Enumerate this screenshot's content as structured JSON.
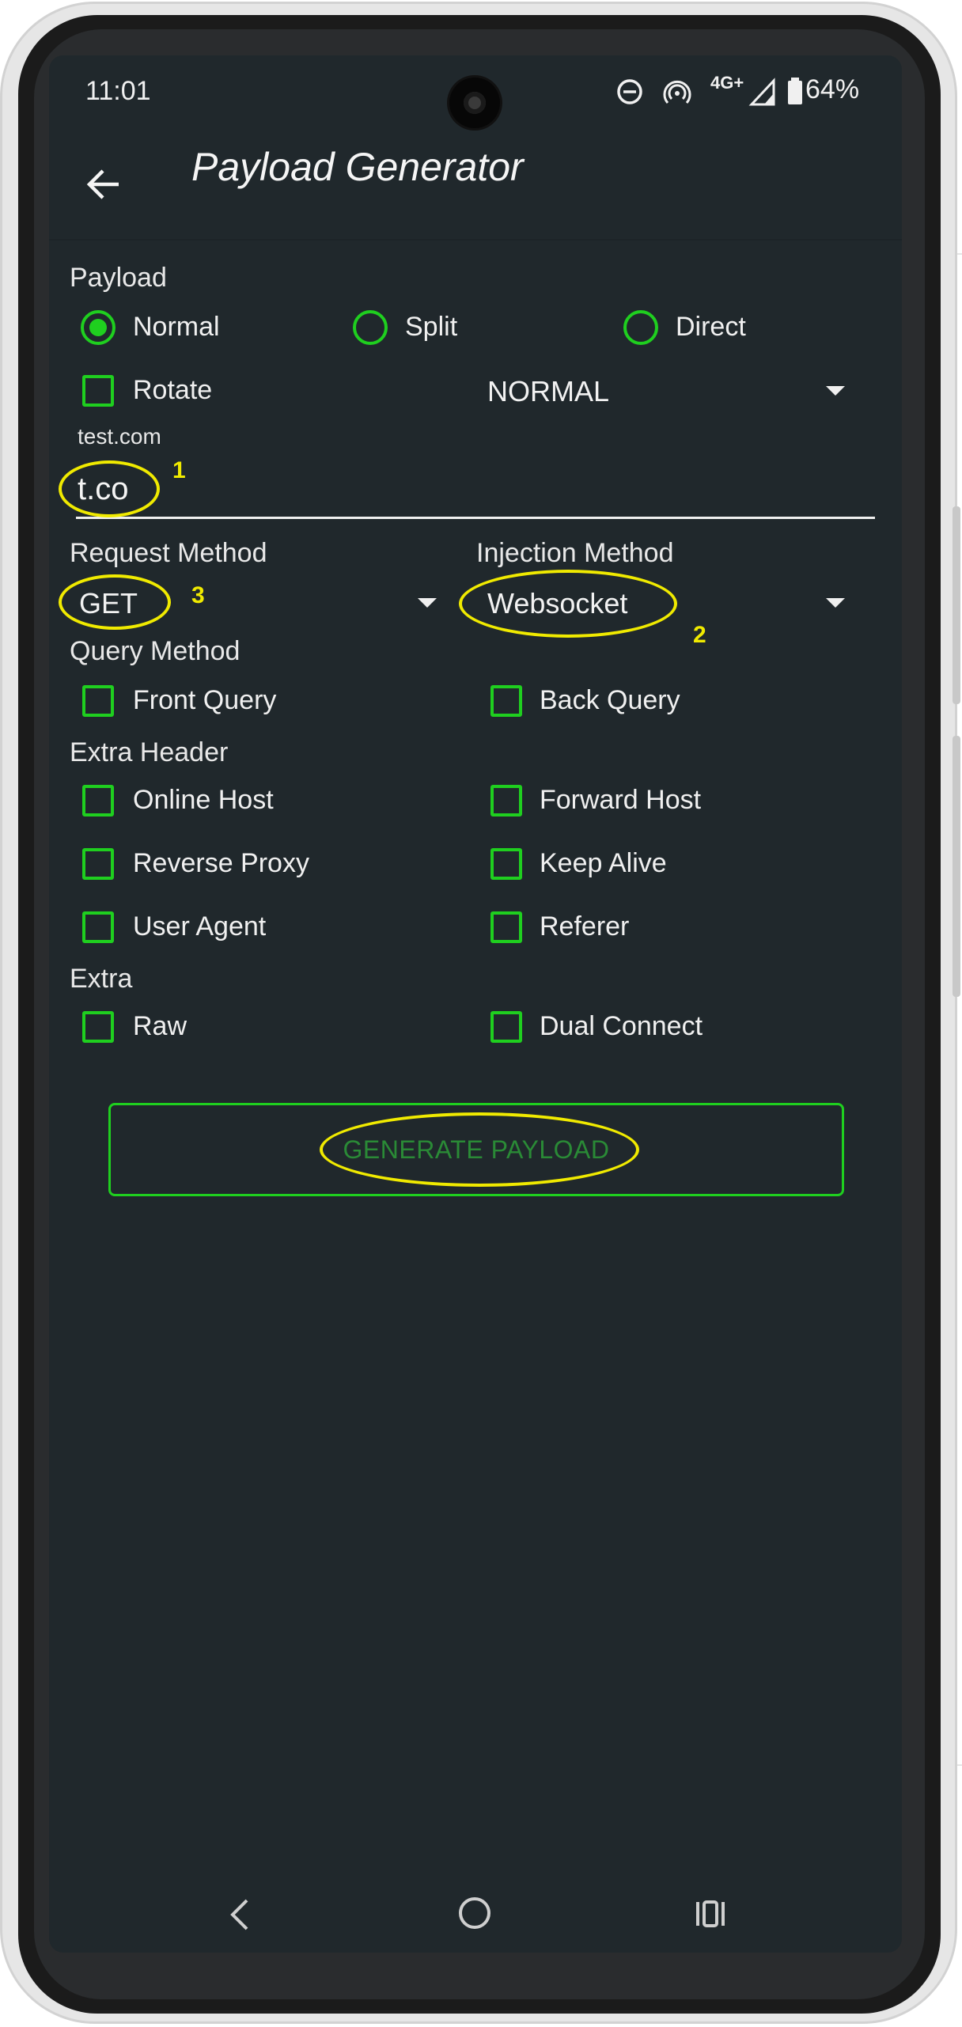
{
  "status_bar": {
    "time": "11:01",
    "network": "4G+",
    "battery": "64%"
  },
  "app_bar": {
    "title": "Payload Generator"
  },
  "payload": {
    "label": "Payload",
    "radios": [
      {
        "label": "Normal",
        "selected": true
      },
      {
        "label": "Split",
        "selected": false
      },
      {
        "label": "Direct",
        "selected": false
      }
    ],
    "rotate_label": "Rotate",
    "mode_value": "NORMAL"
  },
  "host": {
    "hint": "test.com",
    "value": "t.co"
  },
  "request_method": {
    "label": "Request Method",
    "value": "GET"
  },
  "injection_method": {
    "label": "Injection Method",
    "value": "Websocket"
  },
  "query_method": {
    "label": "Query Method",
    "options": [
      "Front Query",
      "Back Query"
    ]
  },
  "extra_header": {
    "label": "Extra Header",
    "options": [
      "Online Host",
      "Forward Host",
      "Reverse Proxy",
      "Keep Alive",
      "User Agent",
      "Referer"
    ]
  },
  "extra": {
    "label": "Extra",
    "options": [
      "Raw",
      "Dual Connect"
    ]
  },
  "generate_button": {
    "label": "GENERATE PAYLOAD"
  },
  "annotations": {
    "n1": "1",
    "n2": "2",
    "n3": "3"
  },
  "colors": {
    "accent": "#1fcf1f",
    "background": "#20282c",
    "annotation": "#f0ea00",
    "button_text": "#2a8a36"
  }
}
